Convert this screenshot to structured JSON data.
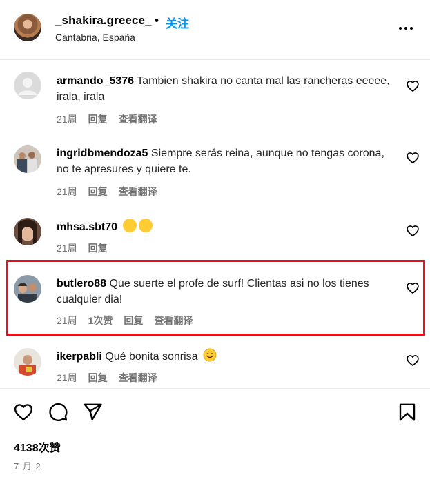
{
  "header": {
    "username": "_shakira.greece_",
    "separator": "•",
    "follow_label": "关注",
    "location": "Cantabria, España",
    "more_icon": "more-horizontal-icon"
  },
  "comments": [
    {
      "username": "armando_5376",
      "text": "Tambien shakira no canta mal las rancheras eeeee, irala, irala",
      "time": "21周",
      "likes": "",
      "reply_label": "回复",
      "translate_label": "查看翻译"
    },
    {
      "username": "ingridbmendoza5",
      "text": "Siempre serás reina, aunque no tengas corona, no te apresures y quiere te.",
      "time": "21周",
      "likes": "",
      "reply_label": "回复",
      "translate_label": "查看翻译"
    },
    {
      "username": "mhsa.sbt70",
      "text": "",
      "emoji": [
        "heart-eyes-emoji",
        "heart-eyes-emoji"
      ],
      "time": "21周",
      "likes": "",
      "reply_label": "回复",
      "translate_label": ""
    },
    {
      "username": "butlero88",
      "text": "Que suerte el profe de surf! Clientas asi no los tienes cualquier dia!",
      "time": "21周",
      "likes": "1次赞",
      "reply_label": "回复",
      "translate_label": "查看翻译",
      "highlighted": true
    },
    {
      "username": "ikerpabli",
      "text": "Qué bonita sonrisa",
      "emoji": [
        "smiling-face-emoji"
      ],
      "time": "21周",
      "likes": "",
      "reply_label": "回复",
      "translate_label": "查看翻译"
    }
  ],
  "actions": {
    "like_icon": "heart-icon",
    "comment_icon": "comment-icon",
    "share_icon": "share-icon",
    "save_icon": "bookmark-icon"
  },
  "likes_count": "4138次赞",
  "post_date": "7 月 2",
  "colors": {
    "accent": "#0095f6",
    "highlight": "#e3141e",
    "meta_text": "#737373"
  }
}
